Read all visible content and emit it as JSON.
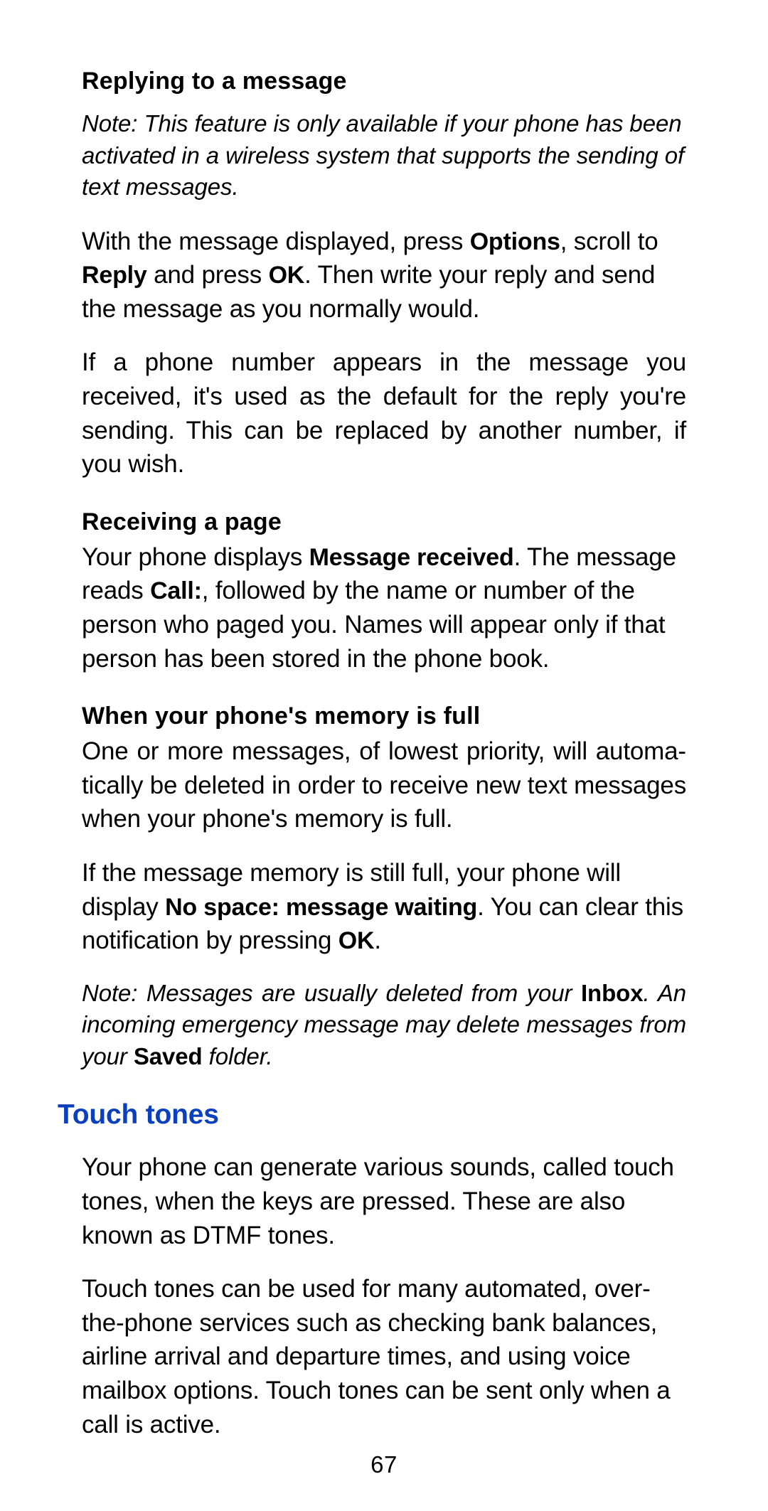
{
  "pageNumber": "67",
  "sections": {
    "replying": {
      "heading": "Replying to a message",
      "note": "Note:  This feature is only available if your phone has been activated in a wireless system that supports the sending of text messages.",
      "p1_a": "With the message displayed, press ",
      "p1_b_bold": "Options",
      "p1_c": ", scroll to ",
      "p1_d_bold": "Reply",
      "p1_e": " and press ",
      "p1_f_bold": "OK",
      "p1_g": ". Then write your reply and send the message as you normally would.",
      "p2": "If a phone number appears in the message you received, it's used as the default for the reply you're sending. This can be replaced by another number, if you wish."
    },
    "receiving": {
      "heading": "Receiving a page",
      "p1_a": "Your phone displays ",
      "p1_b_bold": "Message received",
      "p1_c": ". The message reads ",
      "p1_d_bold": "Call:",
      "p1_e": ", followed by the name or number of the person who paged you. Names will appear only if that person has been stored in the phone book."
    },
    "memoryFull": {
      "heading": "When your phone's memory is full",
      "p1": "One or more messages, of lowest priority, will automa­tically be deleted in order to receive new text messages when your phone's memory is full.",
      "p2_a": "If the message memory is still full, your phone will display ",
      "p2_b_bold": "No space: message waiting",
      "p2_c": ". You can clear this notification by pressing ",
      "p2_d_bold": "OK",
      "p2_e": ".",
      "note_a": "Note: Messages are usually deleted from your ",
      "note_b_bold": "Inbox",
      "note_c": ". An incoming emergency message may delete messages from your ",
      "note_d_bold": "Saved",
      "note_e": " folder."
    },
    "touchTones": {
      "heading": "Touch tones",
      "p1": "Your phone can generate various sounds, called touch tones, when the keys are pressed. These are also known as DTMF tones.",
      "p2": "Touch tones can be used for many automated, over-the-phone services such as checking bank balances, airline arrival and departure times, and using voice mailbox options. Touch tones can be sent only when a call is active."
    }
  }
}
